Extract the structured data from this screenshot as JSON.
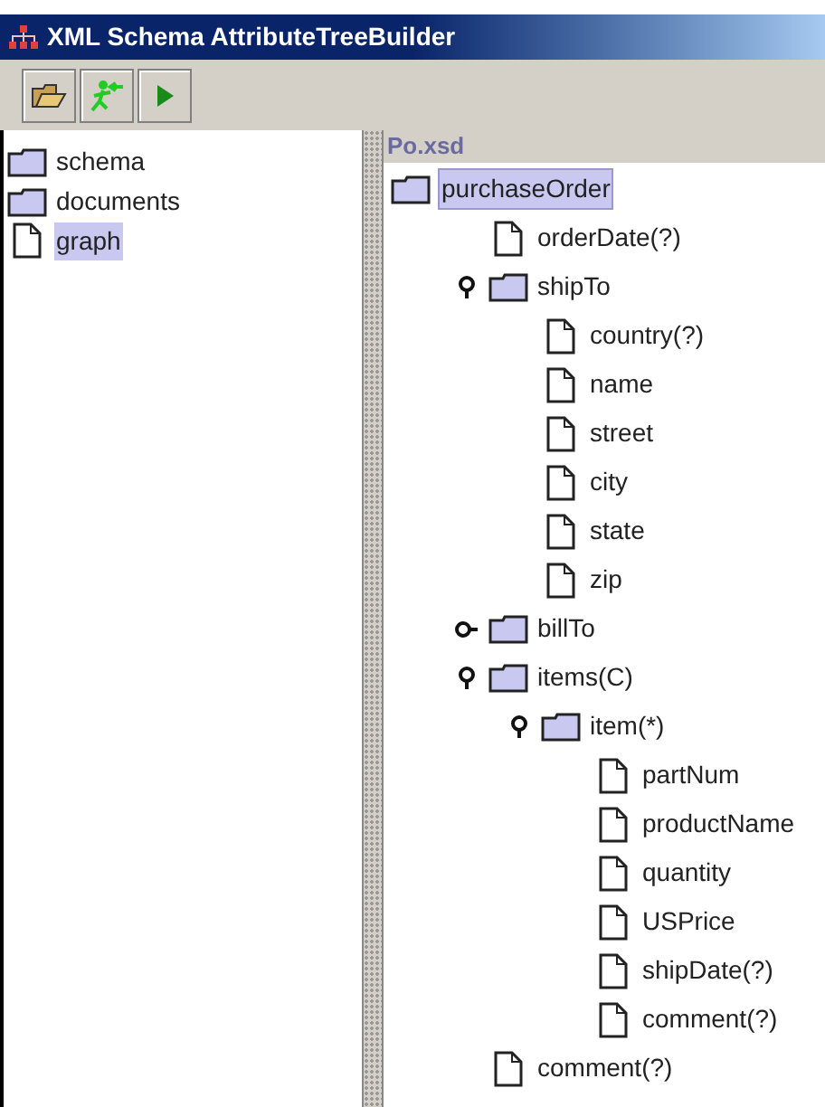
{
  "window": {
    "title": "XML Schema AttributeTreeBuilder"
  },
  "toolbar": [
    {
      "kind": "open"
    },
    {
      "kind": "run-figure"
    },
    {
      "kind": "play"
    }
  ],
  "sidebar": {
    "items": [
      {
        "label": "schema",
        "kind": "folder",
        "selected": false
      },
      {
        "label": "documents",
        "kind": "folder",
        "selected": false
      },
      {
        "label": "graph",
        "kind": "file",
        "selected": true
      }
    ]
  },
  "tree": {
    "title": "Po.xsd",
    "items": [
      {
        "label": "purchaseOrder",
        "kind": "folder",
        "selected": true,
        "children": [
          {
            "label": "orderDate(?)",
            "kind": "file",
            "selected": false
          },
          {
            "label": "shipTo",
            "kind": "folder",
            "selected": false,
            "expanded": true,
            "children": [
              {
                "label": "country(?)",
                "kind": "file",
                "selected": false
              },
              {
                "label": "name",
                "kind": "file",
                "selected": false
              },
              {
                "label": "street",
                "kind": "file",
                "selected": false
              },
              {
                "label": "city",
                "kind": "file",
                "selected": false
              },
              {
                "label": "state",
                "kind": "file",
                "selected": false
              },
              {
                "label": "zip",
                "kind": "file",
                "selected": false
              }
            ]
          },
          {
            "label": "billTo",
            "kind": "folder",
            "selected": false,
            "expanded": false
          },
          {
            "label": "items(C)",
            "kind": "folder",
            "selected": false,
            "expanded": true,
            "children": [
              {
                "label": "item(*)",
                "kind": "folder",
                "selected": false,
                "expanded": true,
                "children": [
                  {
                    "label": "partNum",
                    "kind": "file",
                    "selected": false
                  },
                  {
                    "label": "productName",
                    "kind": "file",
                    "selected": false
                  },
                  {
                    "label": "quantity",
                    "kind": "file",
                    "selected": false
                  },
                  {
                    "label": "USPrice",
                    "kind": "file",
                    "selected": false
                  },
                  {
                    "label": "shipDate(?)",
                    "kind": "file",
                    "selected": false
                  },
                  {
                    "label": "comment(?)",
                    "kind": "file",
                    "selected": false
                  }
                ]
              }
            ]
          },
          {
            "label": "comment(?)",
            "kind": "file",
            "selected": false
          }
        ]
      }
    ]
  }
}
